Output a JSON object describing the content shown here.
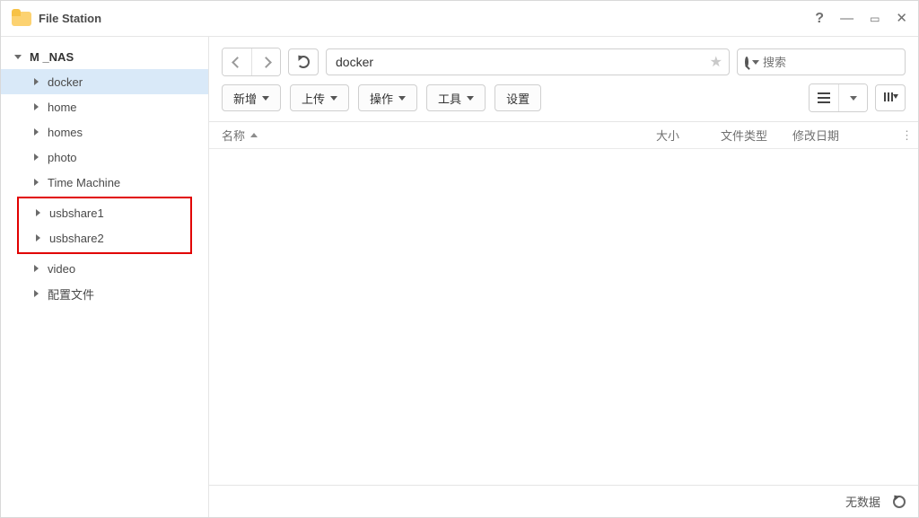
{
  "app": {
    "title": "File Station"
  },
  "sidebar": {
    "root_label": "M   _NAS",
    "items": [
      {
        "label": "docker",
        "selected": true
      },
      {
        "label": "home"
      },
      {
        "label": "homes"
      },
      {
        "label": "photo"
      },
      {
        "label": "Time Machine"
      },
      {
        "label": "usbshare1",
        "highlighted": true
      },
      {
        "label": "usbshare2",
        "highlighted": true
      },
      {
        "label": "video"
      },
      {
        "label": "配置文件"
      }
    ]
  },
  "pathbar": {
    "path": "docker"
  },
  "search": {
    "placeholder": "搜索"
  },
  "actions": {
    "new": "新增",
    "upload": "上传",
    "operate": "操作",
    "tool": "工具",
    "settings": "设置"
  },
  "columns": {
    "name": "名称",
    "size": "大小",
    "type": "文件类型",
    "date": "修改日期"
  },
  "status": {
    "empty": "无数据"
  }
}
